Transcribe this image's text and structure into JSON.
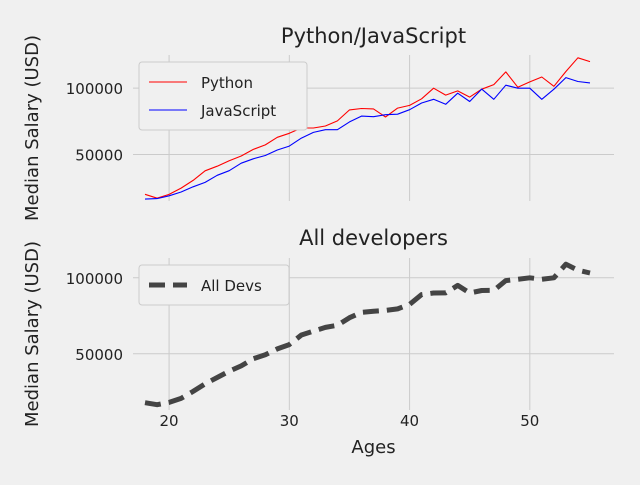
{
  "figure": {
    "background": "#f0f0f0",
    "grid_color": "#cbcbcb"
  },
  "chart_data": [
    {
      "type": "line",
      "title": "Python/JavaScript",
      "xlabel": "",
      "ylabel": "Median Salary (USD)",
      "xlim": [
        17,
        57
      ],
      "ylim": [
        15000,
        125000
      ],
      "xticks": [
        20,
        30,
        40,
        50
      ],
      "yticks": [
        50000,
        100000
      ],
      "show_xtick_labels": false,
      "grid": true,
      "legend": "top-left",
      "x": [
        18,
        19,
        20,
        21,
        22,
        23,
        24,
        25,
        26,
        27,
        28,
        29,
        30,
        31,
        32,
        33,
        34,
        35,
        36,
        37,
        38,
        39,
        40,
        41,
        42,
        43,
        44,
        45,
        46,
        47,
        48,
        49,
        50,
        51,
        52,
        53,
        54,
        55
      ],
      "series": [
        {
          "name": "Python",
          "color": "#ff0000",
          "style": "solid",
          "values": [
            20046,
            17100,
            20000,
            24744,
            30500,
            37732,
            41247,
            45372,
            48876,
            53850,
            57287,
            63016,
            65998,
            70003,
            70000,
            71496,
            75370,
            83640,
            84666,
            84392,
            78254,
            85000,
            87038,
            91991,
            100000,
            94796,
            97962,
            93302,
            99240,
            102736,
            112285,
            100771,
            104708,
            108423,
            101407,
            112542,
            122870,
            120000
          ]
        },
        {
          "name": "JavaScript",
          "color": "#0000ff",
          "style": "solid",
          "values": [
            16446,
            16791,
            18942,
            21780,
            25704,
            29000,
            34372,
            37810,
            43515,
            46823,
            49293,
            53437,
            56373,
            62375,
            66674,
            68745,
            68746,
            74583,
            79000,
            78508,
            79996,
            80403,
            83820,
            88833,
            91660,
            87892,
            96243,
            90000,
            99313,
            91660,
            102264,
            100000,
            100000,
            91660,
            99240,
            108000,
            105000,
            104000
          ]
        }
      ]
    },
    {
      "type": "line",
      "title": "All developers",
      "xlabel": "Ages",
      "ylabel": "Median Salary (USD)",
      "xlim": [
        17,
        57
      ],
      "ylim": [
        13000,
        113000
      ],
      "xticks": [
        20,
        30,
        40,
        50
      ],
      "yticks": [
        50000,
        100000
      ],
      "show_xtick_labels": true,
      "grid": true,
      "legend": "top-left",
      "x": [
        18,
        19,
        20,
        21,
        22,
        23,
        24,
        25,
        26,
        27,
        28,
        29,
        30,
        31,
        32,
        33,
        34,
        35,
        36,
        37,
        38,
        39,
        40,
        41,
        42,
        43,
        44,
        45,
        46,
        47,
        48,
        49,
        50,
        51,
        52,
        53,
        54,
        55
      ],
      "series": [
        {
          "name": "All Devs",
          "color": "#444444",
          "style": "dashed",
          "values": [
            17784,
            16500,
            18012,
            20628,
            25206,
            30252,
            34368,
            38496,
            42000,
            46752,
            49320,
            53200,
            56000,
            62316,
            64928,
            67317,
            68748,
            73752,
            77232,
            78000,
            78508,
            79536,
            82488,
            88935,
            90000,
            90056,
            95000,
            90000,
            91633,
            91660,
            98150,
            98964,
            100000,
            98988,
            100000,
            108923,
            105000,
            103117
          ]
        }
      ]
    }
  ]
}
